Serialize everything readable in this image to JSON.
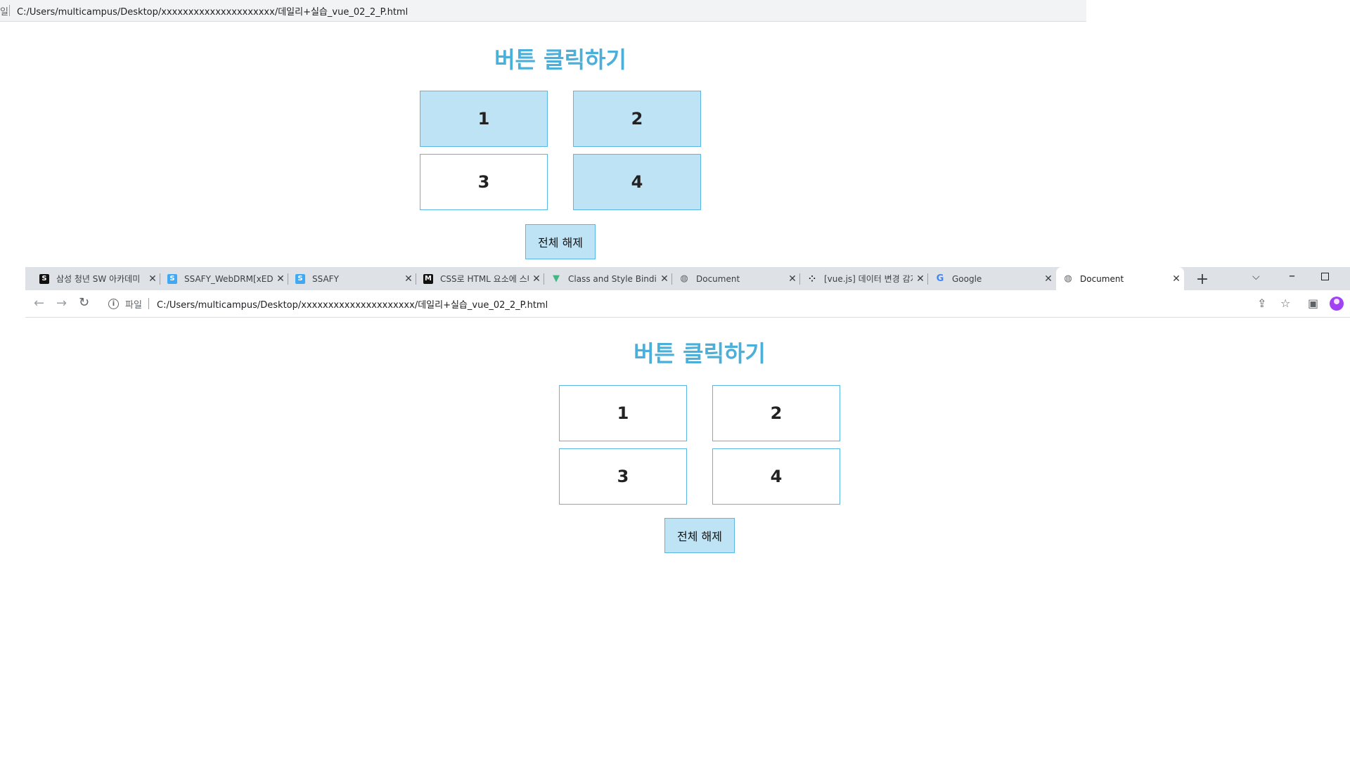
{
  "top_capture": {
    "url_fragment": "일",
    "url": "C:/Users/multicampus/Desktop/xxxxxxxxxxxxxxxxxxxxx/데일리+실습_vue_02_2_P.html",
    "title": "버튼 클릭하기",
    "buttons": [
      {
        "label": "1",
        "active": true
      },
      {
        "label": "2",
        "active": true
      },
      {
        "label": "3",
        "active": false
      },
      {
        "label": "4",
        "active": true
      }
    ],
    "reset_label": "전체 해제"
  },
  "browser": {
    "tabs": [
      {
        "title": "삼성 청년 SW 아카데미",
        "favicon": "s-logo-icon",
        "active": false
      },
      {
        "title": "SSAFY_WebDRM[xED]",
        "favicon": "ssafy-icon",
        "active": false
      },
      {
        "title": "SSAFY",
        "favicon": "ssafy-icon",
        "active": false
      },
      {
        "title": "CSS로 HTML 요소에 스타일",
        "favicon": "mdn-icon",
        "active": false
      },
      {
        "title": "Class and Style Bindings",
        "favicon": "vue-icon",
        "active": false
      },
      {
        "title": "Document",
        "favicon": "globe-icon",
        "active": false
      },
      {
        "title": "[vue.js] 데이터 변경 감지",
        "favicon": "dots-icon",
        "active": false
      },
      {
        "title": "Google",
        "favicon": "google-icon",
        "active": false
      },
      {
        "title": "Document",
        "favicon": "globe-icon",
        "active": true
      }
    ],
    "close_glyph": "✕",
    "new_tab_glyph": "+",
    "file_label": "파일",
    "url": "C:/Users/multicampus/Desktop/xxxxxxxxxxxxxxxxxxxxx/데일리+실습_vue_02_2_P.html"
  },
  "page": {
    "title": "버튼 클릭하기",
    "buttons": [
      {
        "label": "1",
        "active": false
      },
      {
        "label": "2",
        "active": false
      },
      {
        "label": "3",
        "active": false
      },
      {
        "label": "4",
        "active": false
      }
    ],
    "reset_label": "전체 해제"
  },
  "colors": {
    "title": "#4ab0da",
    "active_button_bg": "#bde3f4",
    "button_border": "#5ab7e3",
    "reset_bg": "#bde3f4"
  }
}
